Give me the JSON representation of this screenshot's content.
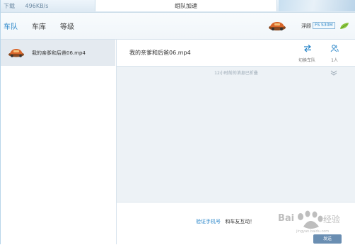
{
  "titlebar": {
    "download_label": "下载",
    "download_speed": "496KB/s",
    "title": "组队加速"
  },
  "nav": {
    "items": [
      {
        "label": "车队",
        "active": true
      },
      {
        "label": "车库",
        "active": false
      },
      {
        "label": "等级",
        "active": false
      }
    ],
    "float_label": "浮顾",
    "badge": "FS S30M"
  },
  "sidebar": {
    "items": [
      {
        "label": "我的亲爹和后爸06.mp4"
      }
    ]
  },
  "main": {
    "title": "我的亲爹和后爸06.mp4",
    "switch_label": "切换车队",
    "members_label": "1人",
    "history_note": "12小时前的消息已折叠",
    "verify_link": "验证手机号",
    "verify_text": "和车友互动！",
    "send_label": "发送"
  },
  "watermark": {
    "text": "Baidu 经验",
    "sub": "jingyan.baidu.com"
  },
  "colors": {
    "accent": "#2a86c9",
    "sidebar_selected": "#e4eaf0",
    "main_bg": "#edf2f6"
  },
  "icons": [
    "car-icon",
    "leaf-icon",
    "switch-icon",
    "members-icon",
    "chevron-down-icon",
    "paw-icon"
  ]
}
